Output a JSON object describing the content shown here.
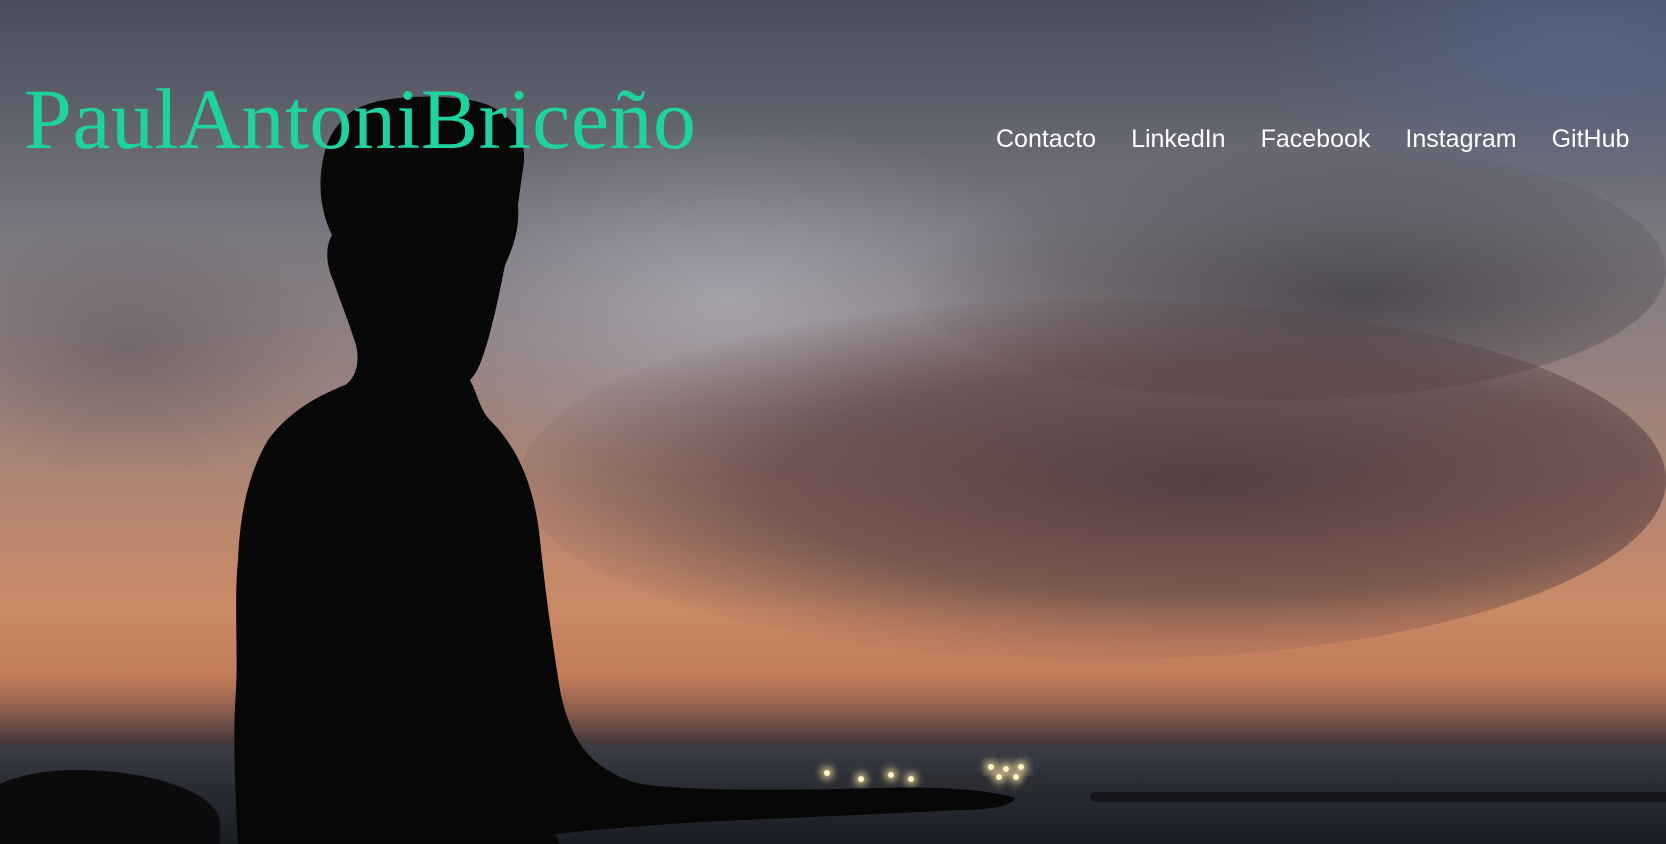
{
  "header": {
    "site_title": "PaulAntoniBriceño",
    "nav": [
      {
        "label": "Contacto"
      },
      {
        "label": "LinkedIn"
      },
      {
        "label": "Facebook"
      },
      {
        "label": "Instagram"
      },
      {
        "label": "GitHub"
      }
    ]
  },
  "colors": {
    "title": "#1ed3a0",
    "nav_text": "#ffffff"
  }
}
